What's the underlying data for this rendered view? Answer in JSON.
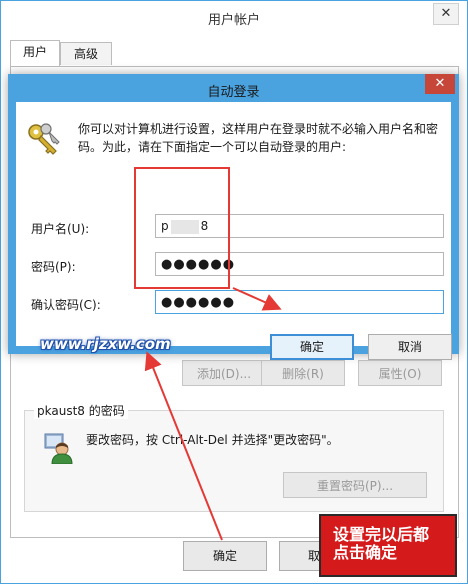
{
  "back_window": {
    "title": "用户帐户",
    "close_glyph": "✕",
    "tabs": [
      "用户",
      "高级"
    ],
    "buttons": {
      "add": "添加(D)...",
      "remove": "删除(R)",
      "properties": "属性(O)"
    },
    "password_group": {
      "title": "pkaust8 的密码",
      "text": "要改密码，按 Ctrl-Alt-Del 并选择\"更改密码\"。",
      "reset_button": "重置密码(P)..."
    },
    "ok_button": "确定",
    "cancel_button": "取消"
  },
  "dialog": {
    "title": "自动登录",
    "close_glyph": "✕",
    "description": "你可以对计算机进行设置，这样用户在登录时就不必输入用户名和密码。为此，请在下面指定一个可以自动登录的用户:",
    "fields": {
      "username_label": "用户名(U):",
      "username_prefix": "p",
      "username_suffix": "8",
      "password_label": "密码(P):",
      "password_value": "●●●●●●",
      "confirm_label": "确认密码(C):",
      "confirm_value": "●●●●●●"
    },
    "ok_button": "确定",
    "cancel_button": "取消"
  },
  "annotations": {
    "watermark": "www.rjzxw.com",
    "note_line1": "设置完以后都",
    "note_line2": "点击确定",
    "highlight_color": "#e53935"
  },
  "icons": [
    "keys-icon",
    "user-icon",
    "close-icon"
  ],
  "colors": {
    "accent": "#4aa3df",
    "close_red": "#c7463a",
    "annotation_red": "#e53935",
    "note_bg": "#d41a1a"
  }
}
